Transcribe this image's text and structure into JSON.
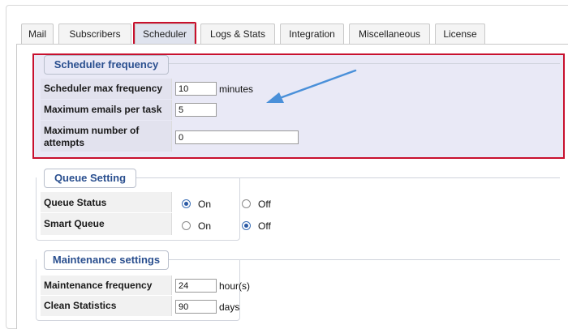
{
  "tabs": [
    {
      "label": "Mail"
    },
    {
      "label": "Subscribers"
    },
    {
      "label": "Scheduler"
    },
    {
      "label": "Logs & Stats"
    },
    {
      "label": "Integration"
    },
    {
      "label": "Miscellaneous"
    },
    {
      "label": "License"
    }
  ],
  "active_tab": "Scheduler",
  "highlight_color": "#c8102e",
  "annotation": {
    "arrow_color": "#4a90d9",
    "icon": "arrow-pointer-icon"
  },
  "scheduler": {
    "legend": "Scheduler frequency",
    "rows": [
      {
        "label": "Scheduler max frequency",
        "value": "10",
        "unit": "minutes"
      },
      {
        "label": "Maximum emails per task",
        "value": "5"
      },
      {
        "label": "Maximum number of attempts",
        "value": "0"
      }
    ]
  },
  "queue": {
    "legend": "Queue Setting",
    "on_label": "On",
    "off_label": "Off",
    "rows": [
      {
        "label": "Queue Status",
        "selected": "On"
      },
      {
        "label": "Smart Queue",
        "selected": "Off"
      }
    ]
  },
  "maintenance": {
    "legend": "Maintenance settings",
    "rows": [
      {
        "label": "Maintenance frequency",
        "value": "24",
        "unit": "hour(s)"
      },
      {
        "label": "Clean Statistics",
        "value": "90",
        "unit": "days"
      }
    ]
  }
}
